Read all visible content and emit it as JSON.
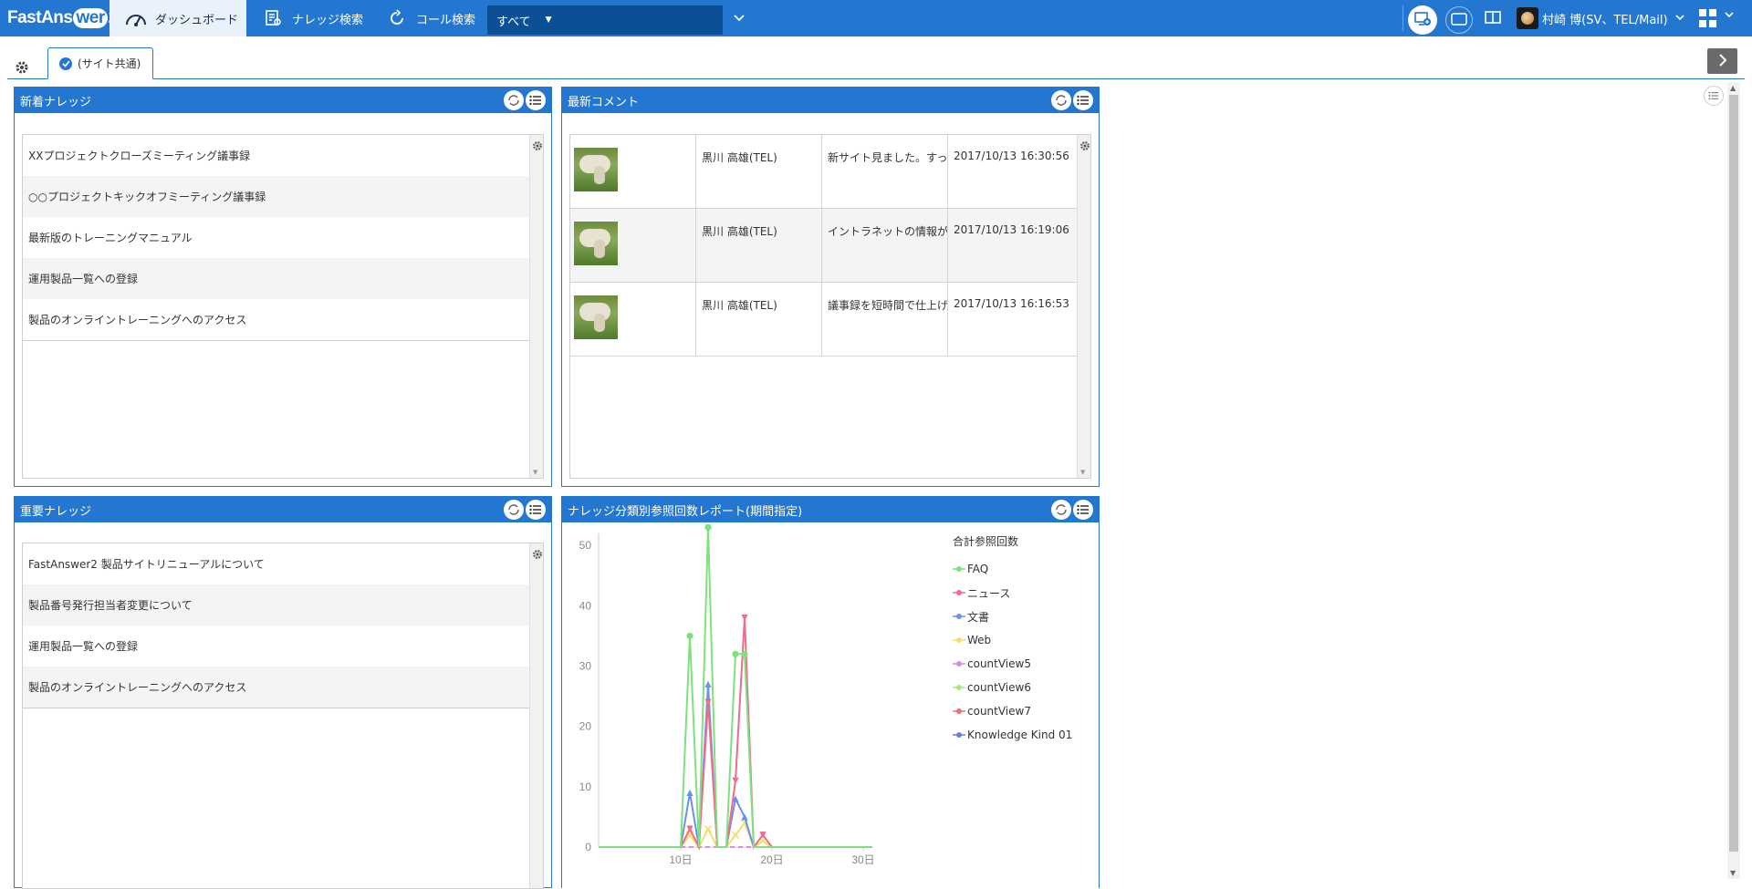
{
  "topbar": {
    "logo": {
      "pre": "FastAns",
      "mid": "wer",
      "post": "2"
    },
    "nav": [
      {
        "label": "ダッシュボード",
        "icon": "gauge-icon"
      },
      {
        "label": "ナレッジ検索",
        "icon": "document-search-icon"
      },
      {
        "label": "コール検索",
        "icon": "phone-call-icon"
      }
    ],
    "scope_select": {
      "value": "すべて"
    },
    "user": {
      "name": "村崎 博(SV、TEL/Mail)"
    }
  },
  "tabs": [
    {
      "label": "(サイト共通)",
      "active": true
    }
  ],
  "panels": {
    "new_knowledge": {
      "title": "新着ナレッジ",
      "items": [
        "XXプロジェクトクローズミーティング議事録",
        "○○プロジェクトキックオフミーティング議事録",
        "最新版のトレーニングマニュアル",
        "運用製品一覧への登録",
        "製品のオンライントレーニングへのアクセス"
      ]
    },
    "latest_comments": {
      "title": "最新コメント",
      "rows": [
        {
          "author": "黒川 高雄(TEL)",
          "comment": "新サイト見ました。すっきりしていい",
          "time": "2017/10/13 16:30:56"
        },
        {
          "author": "黒川 高雄(TEL)",
          "comment": "イントラネットの情報が、見やすく",
          "time": "2017/10/13 16:19:06"
        },
        {
          "author": "黒川 高雄(TEL)",
          "comment": "議事録を短時間で仕上げていただき",
          "time": "2017/10/13 16:16:53"
        }
      ]
    },
    "important_knowledge": {
      "title": "重要ナレッジ",
      "items": [
        "FastAnswer2 製品サイトリニューアルについて",
        "製品番号発行担当者変更について",
        "運用製品一覧への登録",
        "製品のオンライントレーニングへのアクセス"
      ]
    },
    "report": {
      "title": "ナレッジ分類別参照回数レポート(期間指定)"
    }
  },
  "chart_data": {
    "type": "line",
    "title": "",
    "legend_title": "合計参照回数",
    "legend_position": "right",
    "xlabel": "",
    "ylabel": "",
    "ylim": [
      0,
      52
    ],
    "xlim": [
      1,
      31
    ],
    "y_ticks": [
      0,
      10,
      20,
      30,
      40,
      50
    ],
    "x_ticks": [
      10,
      20,
      30
    ],
    "x_tick_format": "{}日",
    "x": [
      1,
      2,
      3,
      4,
      5,
      6,
      7,
      8,
      9,
      10,
      11,
      12,
      13,
      14,
      15,
      16,
      17,
      18,
      19,
      20,
      21,
      22,
      23,
      24,
      25,
      26,
      27,
      28,
      29,
      30,
      31
    ],
    "series": [
      {
        "name": "FAQ",
        "color": "#7ee07e",
        "marker": "circle",
        "values": [
          0,
          0,
          0,
          0,
          0,
          0,
          0,
          0,
          0,
          0,
          35,
          0,
          53,
          0,
          0,
          32,
          32,
          0,
          0,
          0,
          0,
          0,
          0,
          0,
          0,
          0,
          0,
          0,
          0,
          0,
          0
        ]
      },
      {
        "name": "ニュース",
        "color": "#f06a8a",
        "marker": "triangle-down",
        "values": [
          0,
          0,
          0,
          0,
          0,
          0,
          0,
          0,
          0,
          0,
          3,
          0,
          24,
          0,
          0,
          11,
          38,
          0,
          2,
          0,
          0,
          0,
          0,
          0,
          0,
          0,
          0,
          0,
          0,
          0,
          0
        ]
      },
      {
        "name": "文書",
        "color": "#6f8ff0",
        "marker": "triangle-up",
        "values": [
          0,
          0,
          0,
          0,
          0,
          0,
          0,
          0,
          0,
          0,
          9,
          0,
          27,
          0,
          0,
          8,
          5,
          0,
          0,
          0,
          0,
          0,
          0,
          0,
          0,
          0,
          0,
          0,
          0,
          0,
          0
        ]
      },
      {
        "name": "Web",
        "color": "#f2e06a",
        "marker": "x",
        "values": [
          0,
          0,
          0,
          0,
          0,
          0,
          0,
          0,
          0,
          0,
          2,
          0,
          3,
          0,
          0,
          2,
          4,
          0,
          1,
          0,
          0,
          0,
          0,
          0,
          0,
          0,
          0,
          0,
          0,
          0,
          0
        ]
      },
      {
        "name": "countView5",
        "color": "#d98ae8",
        "marker": "plus",
        "values": [
          0,
          0,
          0,
          0,
          0,
          0,
          0,
          0,
          0,
          0,
          0,
          0,
          0,
          0,
          0,
          0,
          0,
          0,
          0,
          0,
          0,
          0,
          0,
          0,
          0,
          0,
          0,
          0,
          0,
          0,
          0
        ]
      },
      {
        "name": "countView6",
        "color": "#a8e880",
        "marker": "diamond",
        "values": [
          0,
          0,
          0,
          0,
          0,
          0,
          0,
          0,
          0,
          0,
          0,
          0,
          0,
          0,
          0,
          0,
          0,
          0,
          0,
          0,
          0,
          0,
          0,
          0,
          0,
          0,
          0,
          0,
          0,
          0,
          0
        ]
      },
      {
        "name": "countView7",
        "color": "#f07070",
        "marker": "square",
        "values": [
          0,
          0,
          0,
          0,
          0,
          0,
          0,
          0,
          0,
          0,
          0,
          0,
          0,
          0,
          0,
          0,
          0,
          0,
          0,
          0,
          0,
          0,
          0,
          0,
          0,
          0,
          0,
          0,
          0,
          0,
          0
        ]
      },
      {
        "name": "Knowledge Kind 01",
        "color": "#6b7ee0",
        "marker": "circle",
        "values": [
          0,
          0,
          0,
          0,
          0,
          0,
          0,
          0,
          0,
          0,
          0,
          0,
          0,
          0,
          0,
          0,
          0,
          0,
          0,
          0,
          0,
          0,
          0,
          0,
          0,
          0,
          0,
          0,
          0,
          0,
          0
        ]
      }
    ]
  }
}
